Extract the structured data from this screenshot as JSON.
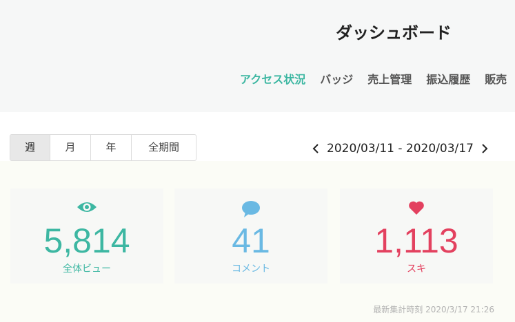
{
  "header": {
    "title": "ダッシュボード",
    "nav": [
      {
        "label": "アクセス状況",
        "active": true
      },
      {
        "label": "バッジ",
        "active": false
      },
      {
        "label": "売上管理",
        "active": false
      },
      {
        "label": "振込履歴",
        "active": false
      },
      {
        "label": "販売",
        "active": false
      }
    ]
  },
  "period": {
    "tabs": [
      "週",
      "月",
      "年",
      "全期間"
    ],
    "selected": "週"
  },
  "date_range": {
    "text": "2020/03/11 - 2020/03/17",
    "prev_icon": "chevron-left-icon",
    "next_icon": "chevron-right-icon"
  },
  "stats": [
    {
      "key": "views",
      "value": "5,814",
      "label": "全体ビュー",
      "icon": "eye-icon",
      "color": "#3db7a2"
    },
    {
      "key": "comments",
      "value": "41",
      "label": "コメント",
      "icon": "speech-bubble-icon",
      "color": "#6ab9e3"
    },
    {
      "key": "likes",
      "value": "1,113",
      "label": "スキ",
      "icon": "heart-icon",
      "color": "#e3415f"
    }
  ],
  "updated": {
    "label": "最新集計時刻",
    "time": "2020/3/17 21:26"
  }
}
